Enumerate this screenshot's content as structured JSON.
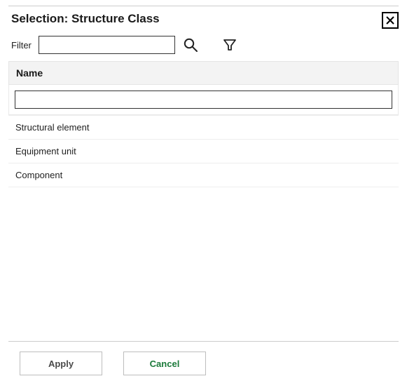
{
  "dialog": {
    "title": "Selection: Structure Class"
  },
  "filter": {
    "label": "Filter",
    "value": ""
  },
  "table": {
    "header": "Name",
    "input_value": "",
    "rows": [
      {
        "name": "Structural element"
      },
      {
        "name": "Equipment unit"
      },
      {
        "name": "Component"
      }
    ]
  },
  "buttons": {
    "apply": "Apply",
    "cancel": "Cancel"
  }
}
